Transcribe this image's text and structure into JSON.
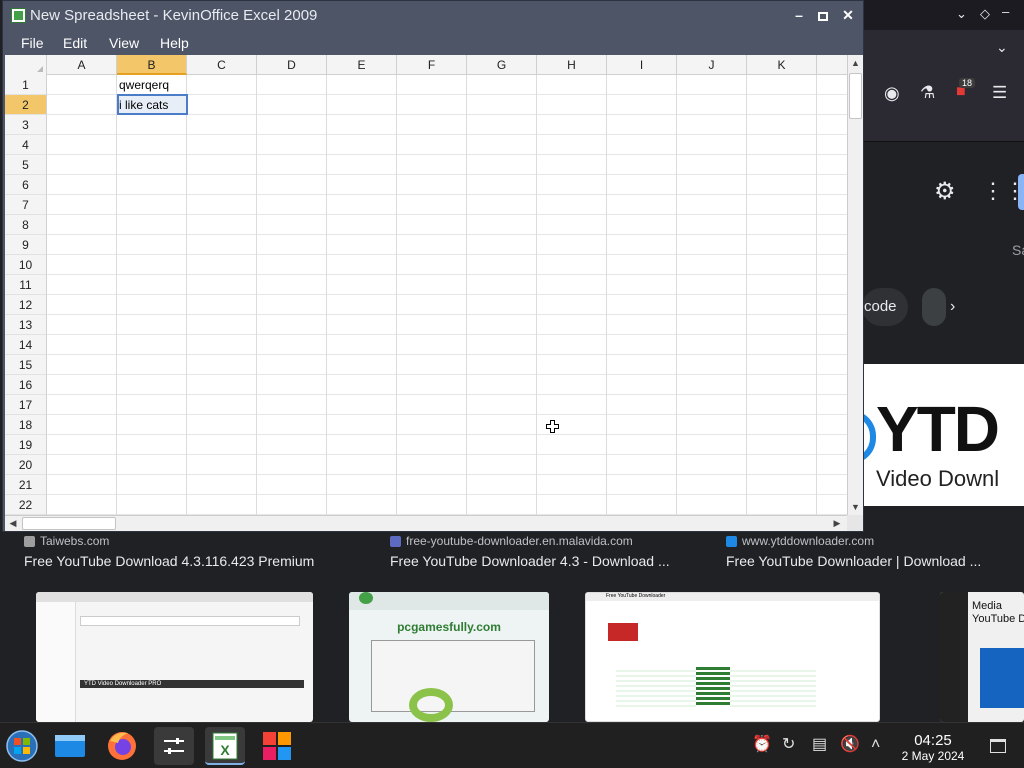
{
  "spreadsheet": {
    "title": "New Spreadsheet - KevinOffice Excel 2009",
    "menu": [
      "File",
      "Edit",
      "View",
      "Help"
    ],
    "columns": [
      "A",
      "B",
      "C",
      "D",
      "E",
      "F",
      "G",
      "H",
      "I",
      "J",
      "K"
    ],
    "rows": [
      "1",
      "2",
      "3",
      "4",
      "5",
      "6",
      "7",
      "8",
      "9",
      "10",
      "11",
      "12",
      "13",
      "14",
      "15",
      "16",
      "17",
      "18",
      "19",
      "20",
      "21",
      "22"
    ],
    "active_column": "B",
    "active_row": "2",
    "cells": {
      "B1": "qwerqerq",
      "B2": "i like cats"
    }
  },
  "browser": {
    "badge_count": "18",
    "chip_text": "code",
    "partial_text": "Sa",
    "banner_big": "YTD",
    "banner_sub": "Video Downl",
    "results": [
      {
        "source": "Taiwebs.com",
        "title": "Free YouTube Download 4.3.116.423 Premium"
      },
      {
        "source": "free-youtube-downloader.en.malavida.com",
        "title": "Free YouTube Downloader 4.3 - Download ..."
      },
      {
        "source": "www.ytddownloader.com",
        "title": "Free YouTube Downloader | Download ..."
      }
    ],
    "thumb_text": "pcgamesfully.com",
    "thumb4_text": "Media YouTube D",
    "thumb_header_1": "YTD Video Downloader PRO",
    "thumb_header_3": "Free YouTube Downloader"
  },
  "taskbar": {
    "time": "04:25",
    "date": "2 May 2024"
  }
}
